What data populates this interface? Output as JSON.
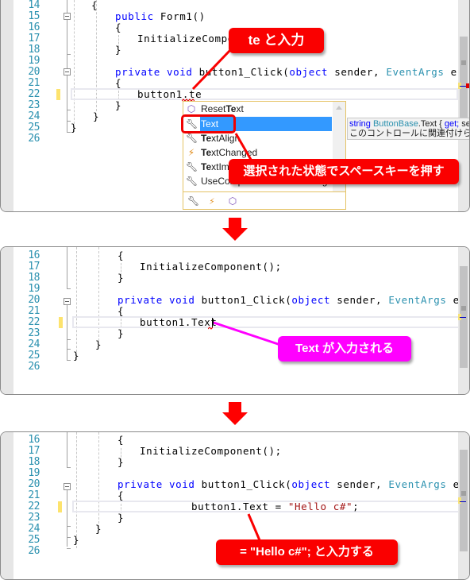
{
  "colors": {
    "keyword": "#0000ff",
    "type": "#2b91af",
    "string": "#a31515",
    "line_number": "#2b91af",
    "callout_red": "#fa0000",
    "callout_pink": "#ff00ff",
    "selection": "#3399ff"
  },
  "panel1": {
    "lines": [
      {
        "num": "14",
        "code": "    {"
      },
      {
        "num": "15",
        "kw": "public",
        "rest": " Form1()"
      },
      {
        "num": "16",
        "code": "    {"
      },
      {
        "num": "17",
        "code": "        InitializeComponent();"
      },
      {
        "num": "18",
        "code": "    }"
      },
      {
        "num": "19",
        "code": ""
      },
      {
        "num": "20",
        "kw": "private void",
        "mid": " button1_Click(",
        "kw2": "object",
        "mid2": " sender, ",
        "ty": "EventArgs",
        "end": " e)"
      },
      {
        "num": "21",
        "code": "    {"
      },
      {
        "num": "22",
        "code": "        button1.te"
      },
      {
        "num": "23",
        "code": "    }"
      },
      {
        "num": "24",
        "code": "}"
      },
      {
        "num": "25",
        "code": "}"
      },
      {
        "num": "26",
        "code": ""
      }
    ],
    "intellisense": {
      "items": [
        {
          "icon": "method-icon",
          "prefix": "Reset",
          "match": "Te",
          "suffix": "xt"
        },
        {
          "icon": "property-icon",
          "prefix": "",
          "match": "Te",
          "suffix": "xt",
          "selected": true
        },
        {
          "icon": "property-icon",
          "prefix": "",
          "match": "Te",
          "suffix": "xtAlign"
        },
        {
          "icon": "event-icon",
          "prefix": "",
          "match": "Te",
          "suffix": "xtChanged"
        },
        {
          "icon": "property-icon",
          "prefix": "",
          "match": "Te",
          "suffix": "xtImageRelation"
        },
        {
          "icon": "property-icon",
          "prefix": "",
          "match": "",
          "suffix": "UseCompatibleTextRendering"
        }
      ],
      "filters": [
        "property-filter",
        "event-filter",
        "method-filter"
      ]
    },
    "tooltip": {
      "line1_type": "string",
      "line1_class": "ButtonBase",
      "line1_member": ".Text { ",
      "line1_get": "get;",
      "line1_rest": " set; }",
      "line2": "このコントロールに関連付けられているテキストです。"
    },
    "callout_top": "te  と入力",
    "callout_bottom": "選択された状態でスペースキーを押す"
  },
  "panel2": {
    "lines": [
      {
        "num": "16",
        "code": "    {"
      },
      {
        "num": "17",
        "code": "        InitializeComponent();"
      },
      {
        "num": "18",
        "code": "    }"
      },
      {
        "num": "19",
        "code": ""
      },
      {
        "num": "20",
        "kw": "private void",
        "mid": " button1_Click(",
        "kw2": "object",
        "mid2": " sender, ",
        "ty": "EventArgs",
        "end": " e)"
      },
      {
        "num": "21",
        "code": "    {"
      },
      {
        "num": "22",
        "code": "        button1.Text "
      },
      {
        "num": "23",
        "code": "    }"
      },
      {
        "num": "24",
        "code": "}"
      },
      {
        "num": "25",
        "code": "}"
      },
      {
        "num": "26",
        "code": ""
      }
    ],
    "callout": "Text が入力される"
  },
  "panel3": {
    "lines": [
      {
        "num": "16",
        "code": "    {"
      },
      {
        "num": "17",
        "code": "        InitializeComponent();"
      },
      {
        "num": "18",
        "code": "    }"
      },
      {
        "num": "19",
        "code": ""
      },
      {
        "num": "20",
        "kw": "private void",
        "mid": " button1_Click(",
        "kw2": "object",
        "mid2": " sender, ",
        "ty": "EventArgs",
        "end": " e)"
      },
      {
        "num": "21",
        "code": "    {"
      },
      {
        "num": "22",
        "pre": "        button1.Text = ",
        "str": "\"Hello c#\"",
        "post": ";"
      },
      {
        "num": "23",
        "code": "    }"
      },
      {
        "num": "24",
        "code": "}"
      },
      {
        "num": "25",
        "code": "}"
      },
      {
        "num": "26",
        "code": ""
      }
    ],
    "callout": "= \"Hello c#\";  と入力する"
  }
}
